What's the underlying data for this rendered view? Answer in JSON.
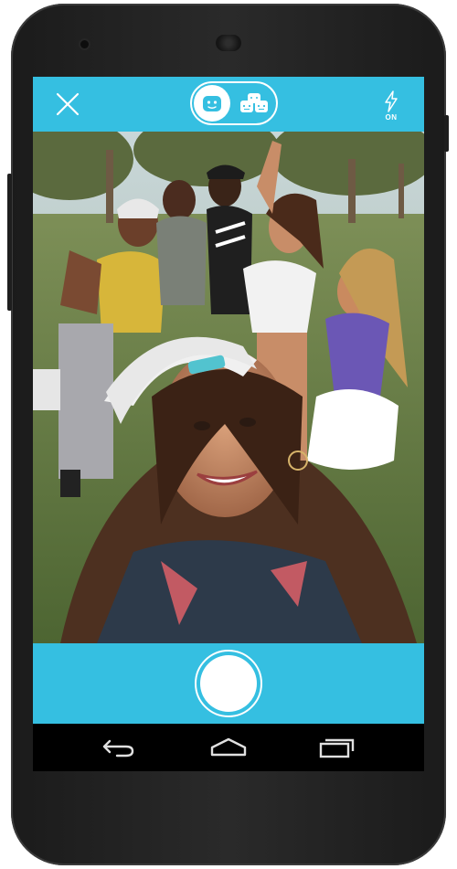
{
  "camera": {
    "flash_status": "ON",
    "mode_options": [
      "single-robot-icon",
      "group-robots-icon"
    ],
    "selected_mode": "single-robot-icon"
  },
  "icons": {
    "close": "close-icon",
    "flash": "flash-icon",
    "shutter": "shutter-button",
    "back": "back-icon",
    "home": "home-icon",
    "recents": "recents-icon"
  },
  "colors": {
    "accent": "#35bfe1",
    "device": "#1b1b1b",
    "nav": "#000000"
  }
}
